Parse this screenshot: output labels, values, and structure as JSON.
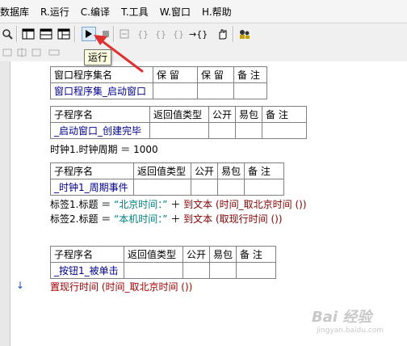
{
  "menu": {
    "items": [
      {
        "label": "数据库"
      },
      {
        "label": "R.运行"
      },
      {
        "label": "C.编译"
      },
      {
        "label": "T.工具"
      },
      {
        "label": "W.窗口"
      },
      {
        "label": "H.帮助"
      }
    ]
  },
  "toolbar": {
    "run_tooltip": "运行"
  },
  "tables": {
    "t1": {
      "headers": [
        "窗口程序集名",
        "保 留",
        "保 留",
        "备 注"
      ],
      "name": "窗口程序集_启动窗口"
    },
    "t2": {
      "headers": [
        "子程序名",
        "返回值类型",
        "公开",
        "易包",
        "备 注"
      ],
      "name": "_启动窗口_创建完毕"
    },
    "t3": {
      "headers": [
        "子程序名",
        "返回值类型",
        "公开",
        "易包",
        "备 注"
      ],
      "name": "_时钟1_周期事件"
    },
    "t4": {
      "headers": [
        "子程序名",
        "返回值类型",
        "公开",
        "易包",
        "备 注"
      ],
      "name": "_按钮1_被单击"
    }
  },
  "code": {
    "line1": "时钟1.时钟周期 ＝ 1000",
    "line2_a": "标签1.标题 ＝ ",
    "line2_b": "“北京时间：”",
    "line2_c": " ＋ ",
    "line2_d": "到文本 (时间_取北京时间 ())",
    "line3_a": "标签2.标题 ＝ ",
    "line3_b": "“本机时间：”",
    "line3_c": " ＋ ",
    "line3_d": "到文本 (取现行时间 ())",
    "line4": "置现行时间 (时间_取北京时间 ())"
  },
  "watermark": {
    "text": "Bai 经验",
    "sub": "jingyan.baidu.com"
  },
  "colors": {
    "annotation_arrow": "#e03030",
    "table_name_text": "#00008b"
  }
}
